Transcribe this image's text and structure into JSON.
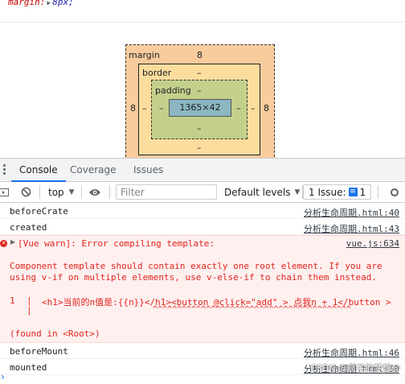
{
  "styles": {
    "margin_prop": "margin",
    "margin_value": "8px;"
  },
  "box_model": {
    "margin_label": "margin",
    "margin_top": "8",
    "margin_left": "8",
    "margin_right": "8",
    "margin_bottom": "–",
    "border_label": "border",
    "border_top": "–",
    "border_left": "–",
    "border_right": "–",
    "border_bottom": "–",
    "padding_label": "padding",
    "padding_top": "–",
    "padding_left": "–",
    "padding_right": "–",
    "padding_bottom": "–",
    "content": "1365×42"
  },
  "drawer": {
    "tabs": [
      "Console",
      "Coverage",
      "Issues"
    ]
  },
  "toolbar": {
    "context": "top",
    "filter_placeholder": "Filter",
    "levels": "Default levels",
    "issues_label": "1 Issue:",
    "issues_count": "1"
  },
  "messages": [
    {
      "text": "beforeCrate",
      "source": "分析生命周期.html:40"
    },
    {
      "text": "created",
      "source": "分析生命周期.html:43"
    },
    {
      "error_title": "[Vue warn]: Error compiling template:",
      "source": "vue.js:634",
      "line1": "Component template should contain exactly one root element. If you are",
      "line2": "using v-if on multiple elements, use v-else-if to chain them instead.",
      "code_lineno": "1",
      "code": "<h1>当前的n值是:{{n}}</h1><button @click=\"add\" > 点我n + 1</button >",
      "carets": "^^^^^^^^^^^^^^^^^^^^^^^^^^^^^^^^^^^^^^^^^",
      "found": "(found in <Root>)"
    },
    {
      "text": "beforeMount",
      "source": "分析生命周期.html:46"
    },
    {
      "text": "mounted",
      "source": "分析生命周期.html:50"
    }
  ],
  "watermark": "CSDN @疯子的梦想@",
  "colors": {
    "accent": "#1a73e8",
    "error": "#e0251c",
    "margin_box": "#f9cc9d",
    "border_box": "#fcdd9e",
    "padding_box": "#c3d08b",
    "content_box": "#8cb6c0"
  }
}
